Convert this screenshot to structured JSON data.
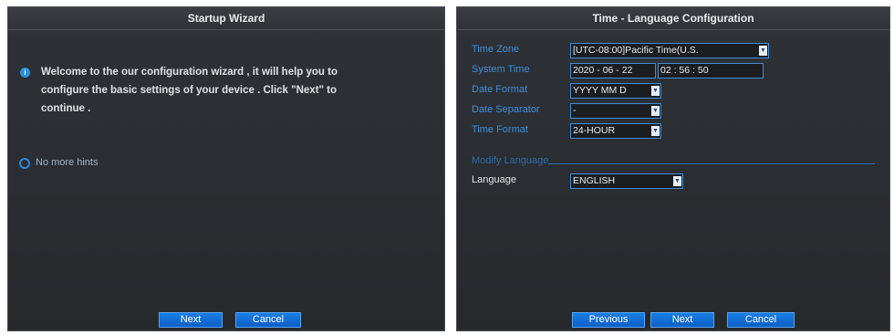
{
  "left": {
    "title": "Startup Wizard",
    "welcome_text": "Welcome to the our configuration wizard , it will help you to configure the basic settings of your device . Click \"Next\" to continue .",
    "no_more_hints": "No more hints",
    "next_label": "Next",
    "cancel_label": "Cancel"
  },
  "right": {
    "title": "Time - Language Configuration",
    "time_zone_label": "Time Zone",
    "time_zone_value": "[UTC-08:00]Pacific Time(U.S.",
    "system_time_label": "System Time",
    "system_date_value": "2020 - 06 - 22",
    "system_clock_value": "02 : 56 : 50",
    "date_format_label": "Date Format",
    "date_format_value": "YYYY MM D",
    "date_separator_label": "Date Separator",
    "date_separator_value": "-",
    "time_format_label": "Time Format",
    "time_format_value": "24-HOUR",
    "modify_language_label": "Modify Language",
    "language_label": "Language",
    "language_value": "ENGLISH",
    "previous_label": "Previous",
    "next_label": "Next",
    "cancel_label": "Cancel"
  },
  "icons": {
    "hint": "info-icon",
    "dropdown": "chevron-down-icon"
  },
  "colors": {
    "panel_bg": "#2c3034",
    "accent": "#1a7ee6",
    "label_blue": "#3f8ddc"
  }
}
